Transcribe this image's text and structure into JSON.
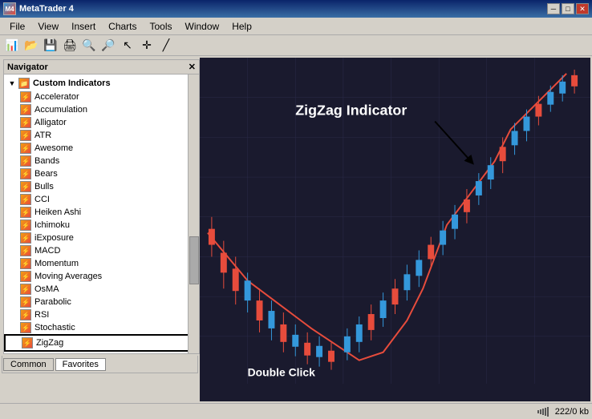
{
  "window": {
    "title": "MetaTrader 4",
    "minimize": "─",
    "restore": "□",
    "close": "✕"
  },
  "menubar": {
    "items": [
      "File",
      "View",
      "Insert",
      "Charts",
      "Tools",
      "Window",
      "Help"
    ]
  },
  "navigator": {
    "title": "Navigator",
    "close": "✕",
    "root": "Custom Indicators",
    "items": [
      "Accelerator",
      "Accumulation",
      "Alligator",
      "ATR",
      "Awesome",
      "Bands",
      "Bears",
      "Bulls",
      "CCI",
      "Heiken Ashi",
      "Ichimoku",
      "iExposure",
      "MACD",
      "Momentum",
      "Moving Averages",
      "OsMA",
      "Parabolic",
      "RSI",
      "Stochastic",
      "ZigZag"
    ]
  },
  "tabs": {
    "common": "Common",
    "favorites": "Favorites"
  },
  "chart": {
    "label": "ZigZag Indicator",
    "double_click": "Double Click"
  },
  "statusbar": {
    "info": "222/0 kb"
  }
}
